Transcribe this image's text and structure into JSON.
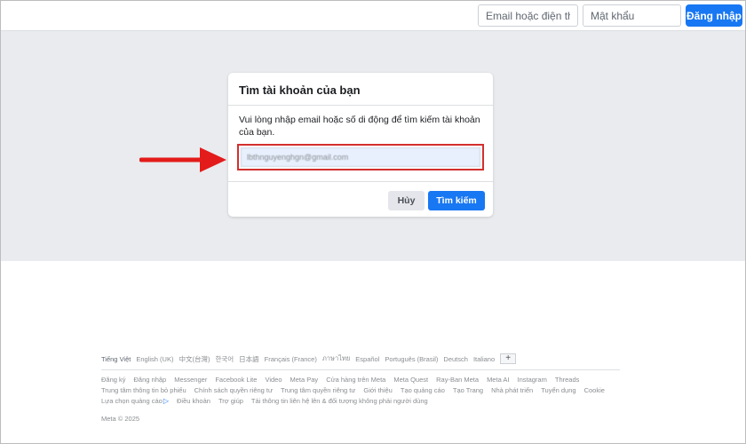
{
  "header": {
    "email_placeholder": "Email hoặc điện thoại",
    "password_placeholder": "Mật khẩu",
    "login_label": "Đăng nhập"
  },
  "dialog": {
    "title": "Tìm tài khoản của bạn",
    "description": "Vui lòng nhập email hoặc số di động để tìm kiếm tài khoản của bạn.",
    "input_value": "lbthnguyenghgn@gmail.com",
    "cancel_label": "Hủy",
    "search_label": "Tìm kiếm"
  },
  "annotation": {
    "arrow_color": "#e31b1b",
    "highlight_color": "#d32f2f"
  },
  "footer": {
    "languages": [
      "Tiếng Việt",
      "English (UK)",
      "中文(台灣)",
      "한국어",
      "日本語",
      "Français (France)",
      "ภาษาไทย",
      "Español",
      "Português (Brasil)",
      "Deutsch",
      "Italiano"
    ],
    "add_language_label": "+",
    "links_row1": [
      "Đăng ký",
      "Đăng nhập",
      "Messenger",
      "Facebook Lite",
      "Video",
      "Meta Pay",
      "Cửa hàng trên Meta",
      "Meta Quest",
      "Ray-Ban Meta",
      "Meta AI",
      "Instagram",
      "Threads"
    ],
    "links_row2": [
      "Trung tâm thông tin bỏ phiếu",
      "Chính sách quyền riêng tư",
      "Trung tâm quyền riêng tư",
      "Giới thiệu",
      "Tạo quảng cáo",
      "Tạo Trang",
      "Nhà phát triển",
      "Tuyển dụng",
      "Cookie"
    ],
    "links_row3": [
      "Lựa chọn quảng cáo",
      "Điều khoản",
      "Trợ giúp",
      "Tải thông tin liên hệ lên & đối tượng không phải người dùng"
    ],
    "adchoices_icon": "adchoices-icon",
    "copyright": "Meta © 2025"
  },
  "colors": {
    "brand_blue": "#1877f2",
    "band_gray": "#e9ebee"
  }
}
